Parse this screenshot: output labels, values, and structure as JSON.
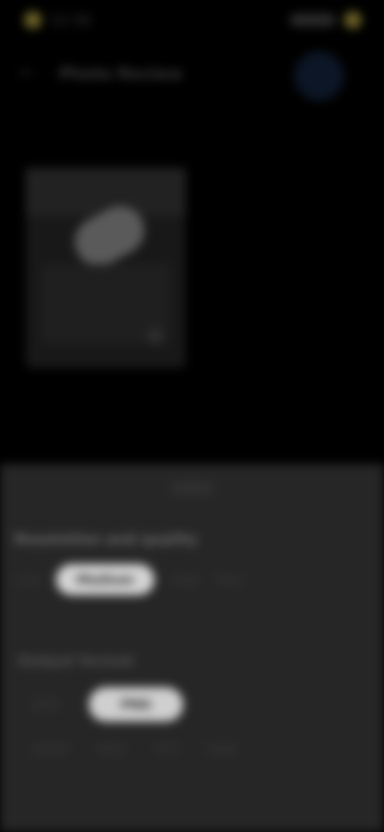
{
  "status_bar": {
    "time": "12:30",
    "right_indicator": ""
  },
  "header": {
    "title": "Photo Review",
    "back_icon": "back-arrow-icon",
    "avatar_icon": "profile-avatar"
  },
  "photo": {
    "alt": "Captured frame"
  },
  "panel": {
    "section1_label": "Resolution and quality",
    "section1_options": [
      "Low",
      "Medium",
      "High",
      "Max"
    ],
    "section2_label": "Output format",
    "section2_row1": [
      "JPEG",
      "PNG"
    ],
    "section2_row2": [
      "WEBP",
      "HEIC",
      "TIFF",
      "RAW"
    ]
  },
  "colors": {
    "background": "#000000",
    "panel": "#262626",
    "pill": "#d4d4d4",
    "accent": "#6b6126"
  }
}
